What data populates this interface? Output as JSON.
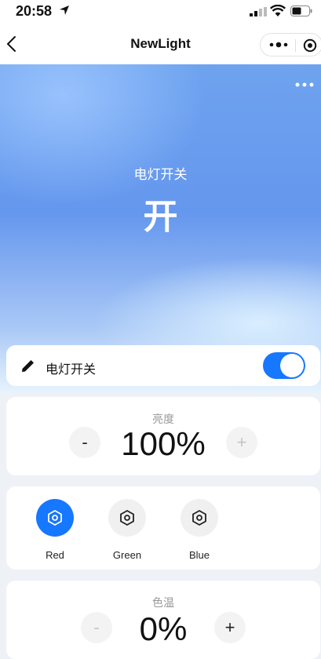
{
  "status_bar": {
    "time": "20:58"
  },
  "nav": {
    "title": "NewLight"
  },
  "hero": {
    "label": "电灯开关",
    "state": "开"
  },
  "switch_card": {
    "label": "电灯开关",
    "on": true
  },
  "brightness": {
    "label": "亮度",
    "value": "100%",
    "minus": "-",
    "plus": "+"
  },
  "colors": [
    {
      "name": "Red",
      "active": true
    },
    {
      "name": "Green",
      "active": false
    },
    {
      "name": "Blue",
      "active": false
    }
  ],
  "color_temp": {
    "label": "色温",
    "value": "0%",
    "minus": "-",
    "plus": "+"
  },
  "accent": "#1677ff"
}
